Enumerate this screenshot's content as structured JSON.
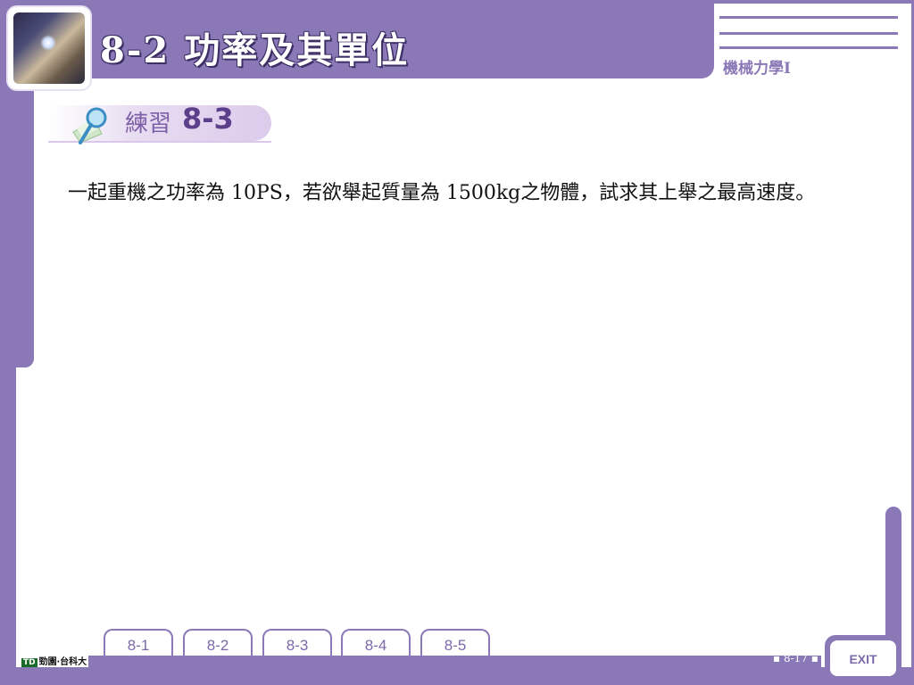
{
  "header": {
    "title": "8-2  功率及其單位",
    "course": "機械力學I"
  },
  "exercise": {
    "label": "練習",
    "number": "8-3"
  },
  "problem": {
    "text": "一起重機之功率為 10PS，若欲舉起質量為 1500kg之物體，試求其上舉之最高速度。"
  },
  "nav": {
    "tabs": [
      {
        "label": "8-1"
      },
      {
        "label": "8-2"
      },
      {
        "label": "8-3"
      },
      {
        "label": "8-4"
      },
      {
        "label": "8-5"
      }
    ],
    "exit_label": "EXIT"
  },
  "footer": {
    "page_number": "8-17",
    "publisher_icon": "TD",
    "publisher_name": "勁園‧台科大"
  },
  "colors": {
    "frame": "#8b78b6",
    "accent_dark": "#5b3f8a"
  }
}
